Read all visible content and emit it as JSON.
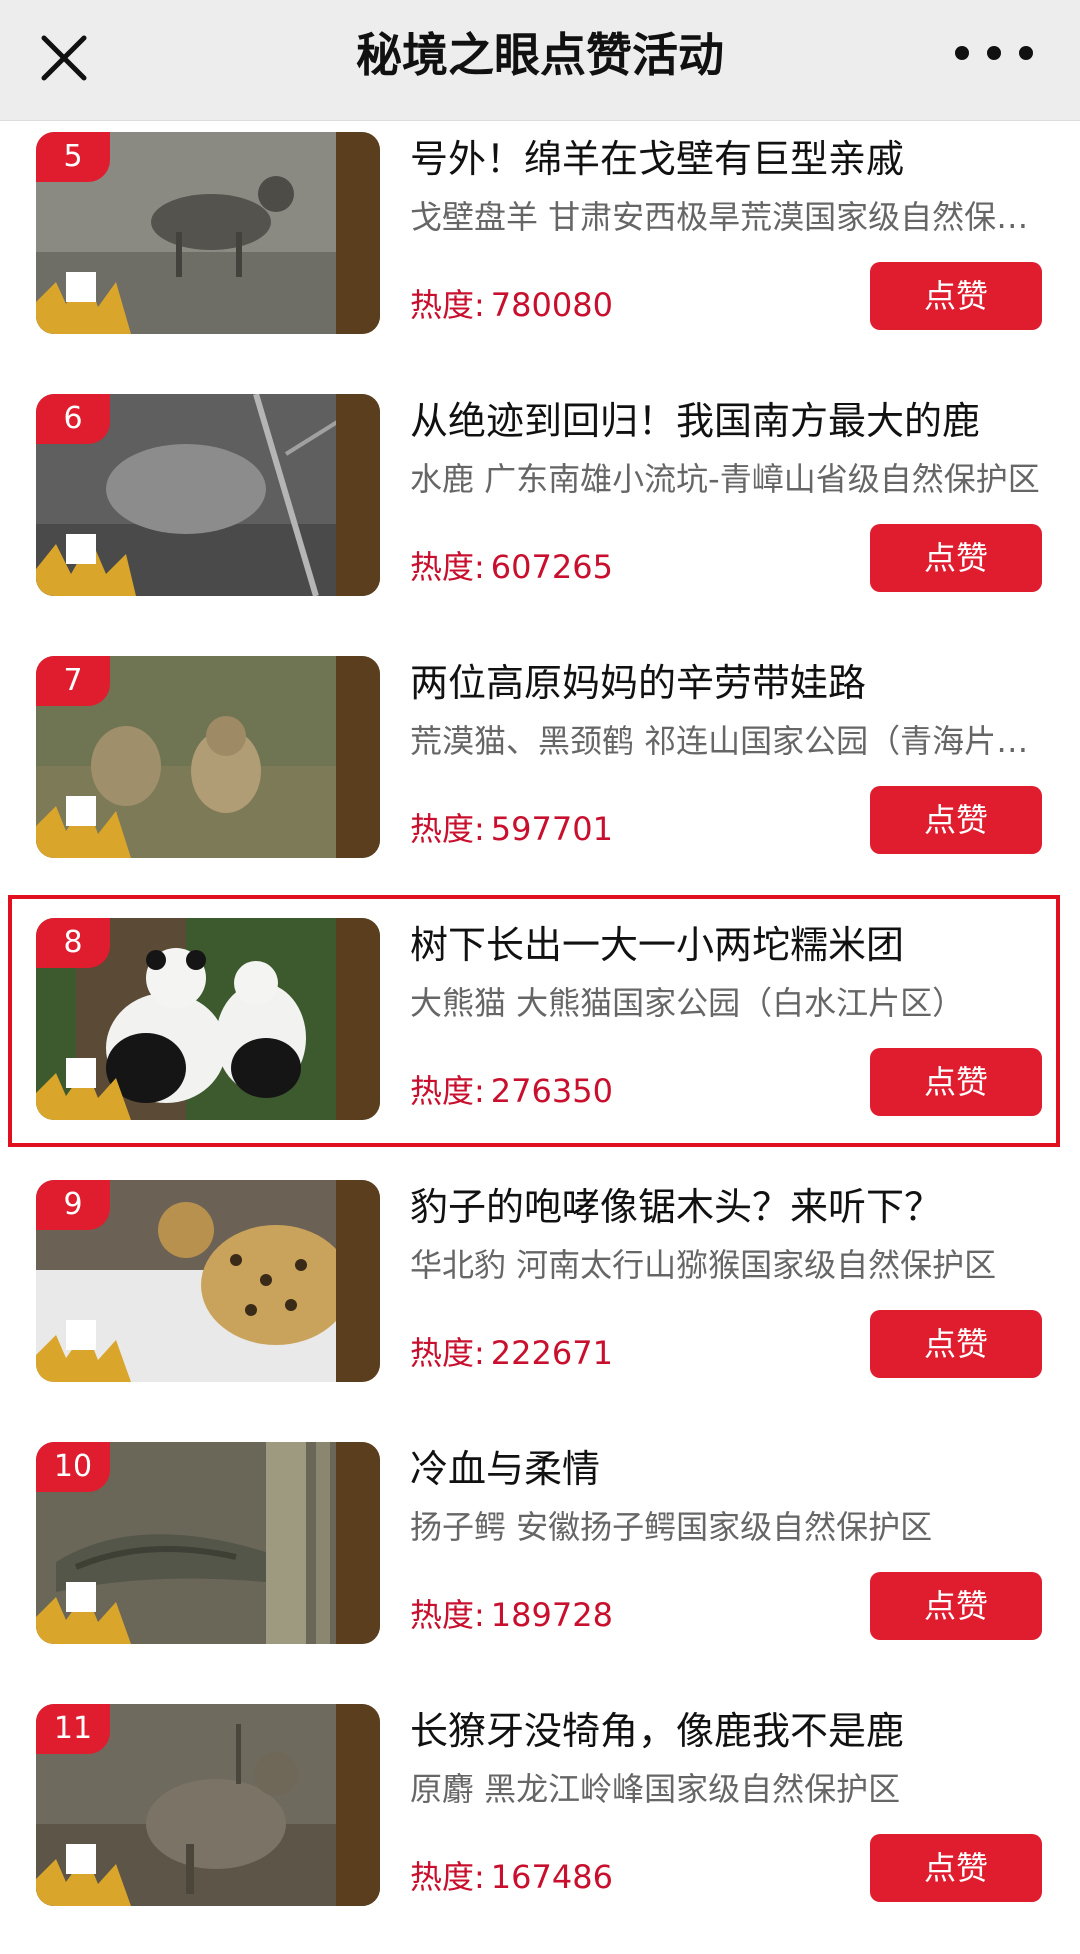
{
  "header": {
    "title": "秘境之眼点赞活动"
  },
  "colors": {
    "accent": "#e01d2f",
    "heat_text": "#c8102e",
    "highlight_border": "#e0101e"
  },
  "icons": {
    "close": "close-icon",
    "more": "more-icon"
  },
  "items": [
    {
      "rank": "5",
      "title": "号外！绵羊在戈壁有巨型亲戚",
      "subtitle": "戈壁盘羊 甘肃安西极旱荒漠国家级自然保护区",
      "heat_label": "热度:",
      "heat_value": "780080",
      "button_label": "点赞"
    },
    {
      "rank": "6",
      "title": "从绝迹到回归！我国南方最大的鹿",
      "subtitle": "水鹿 广东南雄小流坑-青嶂山省级自然保护区",
      "heat_label": "热度:",
      "heat_value": "607265",
      "button_label": "点赞"
    },
    {
      "rank": "7",
      "title": "两位高原妈妈的辛劳带娃路",
      "subtitle": "荒漠猫、黑颈鹤 祁连山国家公园（青海片区）",
      "heat_label": "热度:",
      "heat_value": "597701",
      "button_label": "点赞"
    },
    {
      "rank": "8",
      "title": "树下长出一大一小两坨糯米团",
      "subtitle": "大熊猫 大熊猫国家公园（白水江片区）",
      "heat_label": "热度:",
      "heat_value": "276350",
      "button_label": "点赞",
      "highlighted": true
    },
    {
      "rank": "9",
      "title": "豹子的咆哮像锯木头？来听下？",
      "subtitle": "华北豹 河南太行山猕猴国家级自然保护区",
      "heat_label": "热度:",
      "heat_value": "222671",
      "button_label": "点赞"
    },
    {
      "rank": "10",
      "title": "冷血与柔情",
      "subtitle": "扬子鳄 安徽扬子鳄国家级自然保护区",
      "heat_label": "热度:",
      "heat_value": "189728",
      "button_label": "点赞"
    },
    {
      "rank": "11",
      "title": "长獠牙没犄角，像鹿我不是鹿",
      "subtitle": "原麝 黑龙江岭峰国家级自然保护区",
      "heat_label": "热度:",
      "heat_value": "167486",
      "button_label": "点赞"
    }
  ]
}
